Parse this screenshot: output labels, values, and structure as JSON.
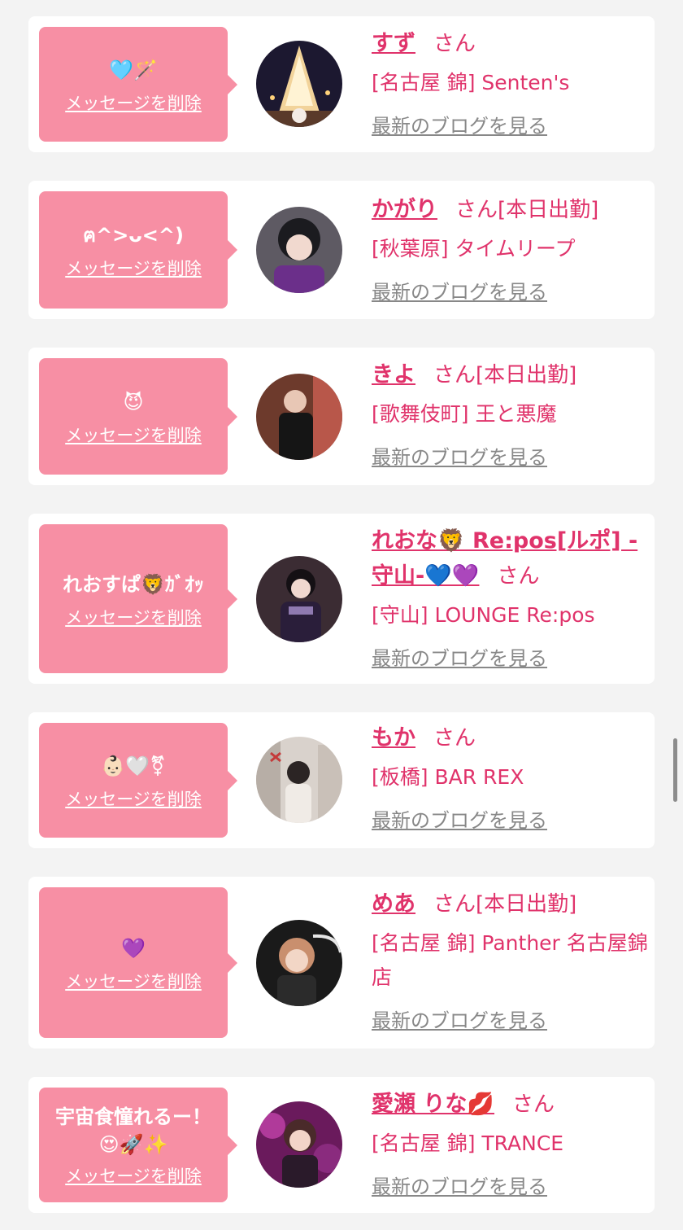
{
  "colors": {
    "bubble": "#f78fa4",
    "accent": "#e0336b",
    "link_gray": "#888888",
    "background": "#f3f3f3"
  },
  "delete_label": "メッセージを削除",
  "blog_label": "最新のブログを見る",
  "entries": [
    {
      "message": "🩵🪄",
      "name": "すず",
      "suffix": "さん",
      "work_status": "",
      "shop": "[名古屋 錦] Senten's"
    },
    {
      "message": "ฅ^>ᴗ<^)",
      "name": "かがり",
      "suffix": "さん",
      "work_status": "[本日出勤]",
      "shop": "[秋葉原] タイムリープ"
    },
    {
      "message": "😈",
      "name": "きよ",
      "suffix": "さん",
      "work_status": "[本日出勤]",
      "shop": "[歌舞伎町] 王と悪魔"
    },
    {
      "message": "れおすぱ🦁ｶﾞｵｯ",
      "name": "れおな🦁 Re:pos[ルポ] -守山-💙💜",
      "suffix": "さん",
      "work_status": "",
      "shop": "[守山] LOUNGE Re:pos"
    },
    {
      "message": "👶🏻🤍⚧",
      "name": "もか",
      "suffix": "さん",
      "work_status": "",
      "shop": "[板橋] BAR REX"
    },
    {
      "message": "💜",
      "name": "めあ",
      "suffix": "さん",
      "work_status": "[本日出勤]",
      "shop": "[名古屋 錦] Panther 名古屋錦店"
    },
    {
      "message": "宇宙食憧れるー！😍🚀✨",
      "name": "愛瀬 りな💋",
      "suffix": "さん",
      "work_status": "",
      "shop": "[名古屋 錦] TRANCE"
    }
  ]
}
